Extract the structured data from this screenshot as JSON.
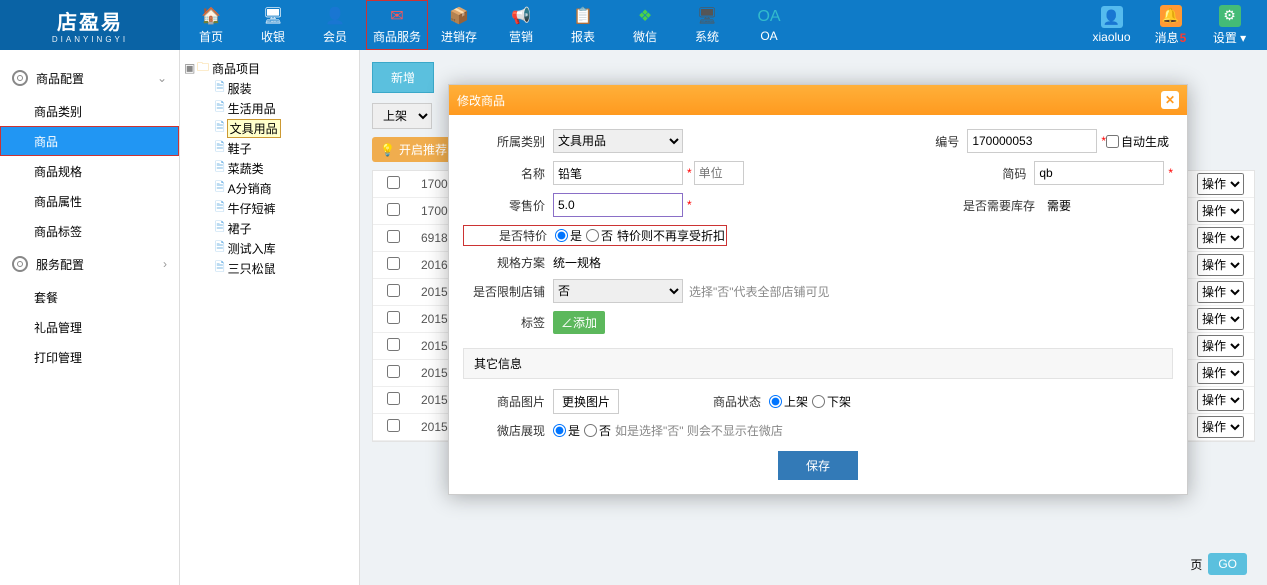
{
  "logo": {
    "main": "店盈易",
    "sub": "DIANYINGYI"
  },
  "nav": [
    {
      "label": "首页",
      "icon": "🏠",
      "c": "#ff6633"
    },
    {
      "label": "收银",
      "icon": "🖥",
      "c": "#fff"
    },
    {
      "label": "会员",
      "icon": "👤",
      "c": "#33cc99"
    },
    {
      "label": "商品服务",
      "icon": "✉",
      "c": "#ff5555",
      "hl": true
    },
    {
      "label": "进销存",
      "icon": "📦",
      "c": "#ffaa33"
    },
    {
      "label": "营销",
      "icon": "📢",
      "c": "#55bbee"
    },
    {
      "label": "报表",
      "icon": "📋",
      "c": "#ffbb55"
    },
    {
      "label": "微信",
      "icon": "❖",
      "c": "#4ad14a"
    },
    {
      "label": "系统",
      "icon": "🖥",
      "c": "#555"
    },
    {
      "label": "OA",
      "icon": "OA",
      "c": "#33bbcc"
    }
  ],
  "navr": {
    "user": "xiaoluo",
    "msg": "消息",
    "msgn": "5",
    "set": "设置"
  },
  "sideA": {
    "title": "商品配置",
    "items": [
      {
        "label": "商品类别"
      },
      {
        "label": "商品",
        "active": true,
        "hl": true
      },
      {
        "label": "商品规格"
      },
      {
        "label": "商品属性"
      },
      {
        "label": "商品标签"
      }
    ]
  },
  "sideB": {
    "title": "服务配置",
    "items": [
      {
        "label": "套餐"
      },
      {
        "label": "礼品管理"
      },
      {
        "label": "打印管理"
      }
    ]
  },
  "tree": {
    "root": "商品项目",
    "children": [
      "服装",
      "生活用品",
      "文具用品",
      "鞋子",
      "菜蔬类",
      "A分销商",
      "牛仔短裤",
      "裙子",
      "测试入库",
      "三只松鼠"
    ],
    "hl": "文具用品"
  },
  "content": {
    "addTab": "新增",
    "statusSel": "上架",
    "recommend": "开启推荐",
    "rows": [
      "1700",
      "1700",
      "6918",
      "2016",
      "2015",
      "2015",
      "2015",
      "2015",
      "2015",
      "2015"
    ],
    "action": "操作",
    "pager": {
      "page": "页",
      "go": "GO"
    }
  },
  "modal": {
    "title": "修改商品",
    "labels": {
      "cat": "所属类别",
      "code": "编号",
      "auto": "自动生成",
      "name": "名称",
      "unit": "单位",
      "short": "简码",
      "price": "零售价",
      "stock": "是否需要库存",
      "stockVal": "需要",
      "special": "是否特价",
      "specialNote": "特价则不再享受折扣",
      "specPlan": "规格方案",
      "specVal": "统一规格",
      "restrict": "是否限制店铺",
      "restrictNote": "选择\"否\"代表全部店铺可见",
      "tag": "标签",
      "tagAdd": "∠添加",
      "other": "其它信息",
      "img": "商品图片",
      "imgBtn": "更换图片",
      "state": "商品状态",
      "up": "上架",
      "down": "下架",
      "wechat": "微店展现",
      "wechatNote": "如是选择\"否\" 则会不显示在微店",
      "yes": "是",
      "no": "否",
      "save": "保存"
    },
    "vals": {
      "cat": "文具用品",
      "code": "170000053",
      "name": "铅笔",
      "short": "qb",
      "price": "5.0",
      "restrict": "否"
    }
  }
}
